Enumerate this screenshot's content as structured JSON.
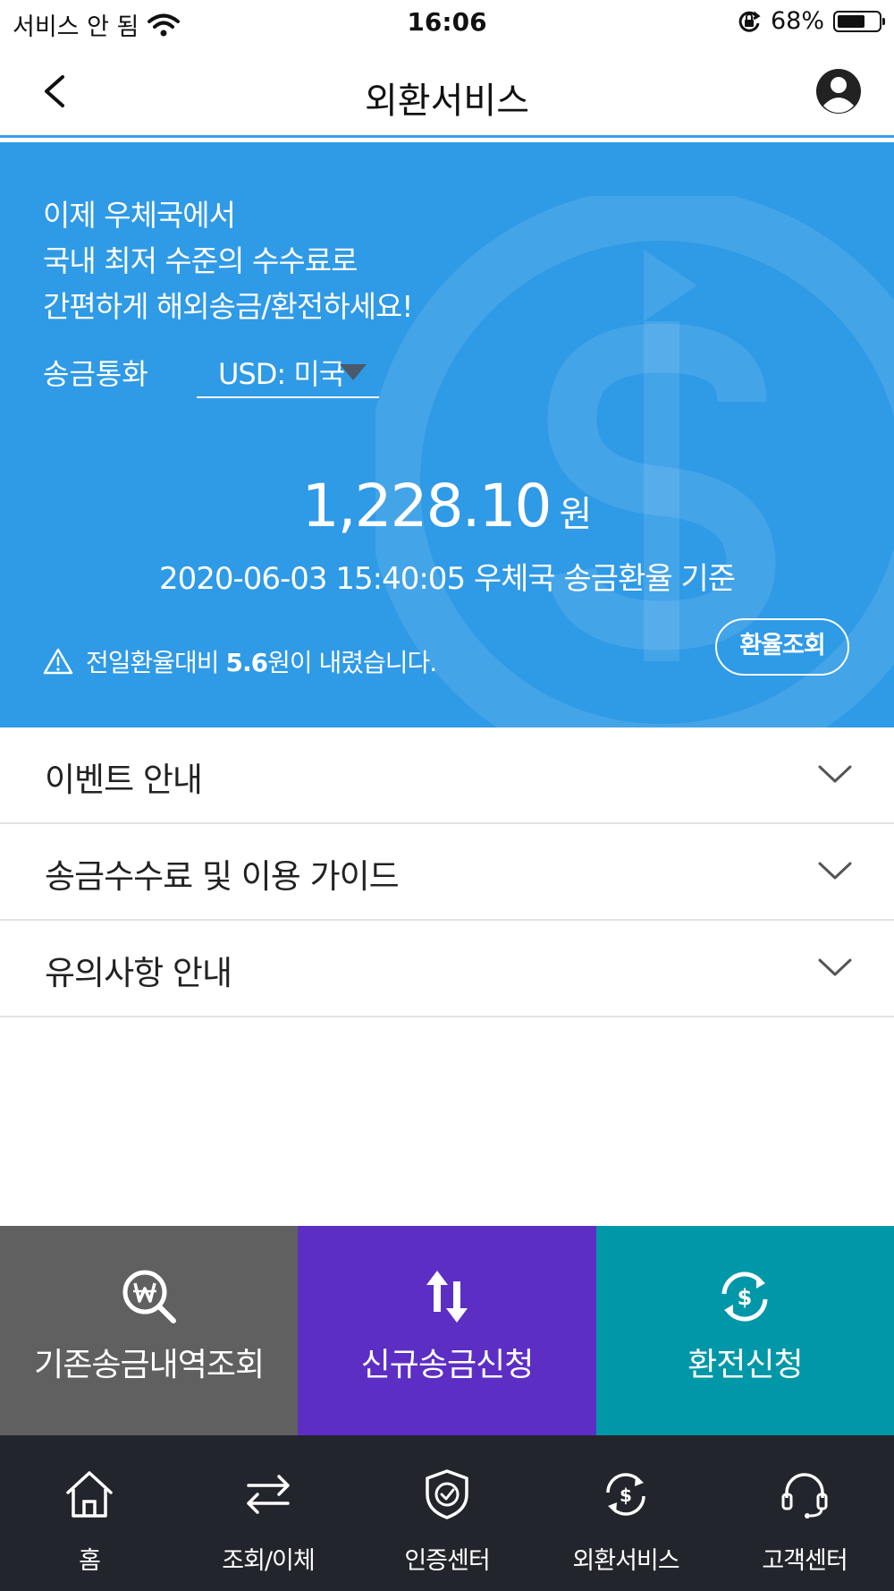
{
  "status_bar": {
    "carrier": "서비스 안 됨",
    "time": "16:06",
    "battery": "68%",
    "battery_level": 0.68
  },
  "header": {
    "title": "외환서비스"
  },
  "hero": {
    "line1": "이제 우체국에서",
    "line2": "국내 최저 수준의 수수료로",
    "line3": "간편하게 해외송금/환전하세요!",
    "currency_label": "송금통화",
    "currency_selected": "USD: 미국",
    "rate_value": "1,228.10",
    "rate_unit": "원",
    "rate_timestamp": "2020-06-03 15:40:05 우체국 송금환율 기준",
    "change_prefix": "전일환율대비",
    "change_amount": "5.6",
    "change_suffix": "원이 내렸습니다.",
    "rate_button": "환율조회"
  },
  "accordion": [
    {
      "label": "이벤트 안내"
    },
    {
      "label": "송금수수료 및 이용 가이드"
    },
    {
      "label": "유의사항 안내"
    }
  ],
  "actions": [
    {
      "label": "기존송금내역조회",
      "color": "#606060"
    },
    {
      "label": "신규송금신청",
      "color": "#5c2ec4"
    },
    {
      "label": "환전신청",
      "color": "#0098a8"
    }
  ],
  "tabs": [
    {
      "label": "홈"
    },
    {
      "label": "조회/이체"
    },
    {
      "label": "인증센터"
    },
    {
      "label": "외환서비스"
    },
    {
      "label": "고객센터"
    }
  ],
  "colors": {
    "hero_bg": "#2f9ae6",
    "tab_bar_bg": "#23252d",
    "header_underline": "#3a9de8"
  }
}
